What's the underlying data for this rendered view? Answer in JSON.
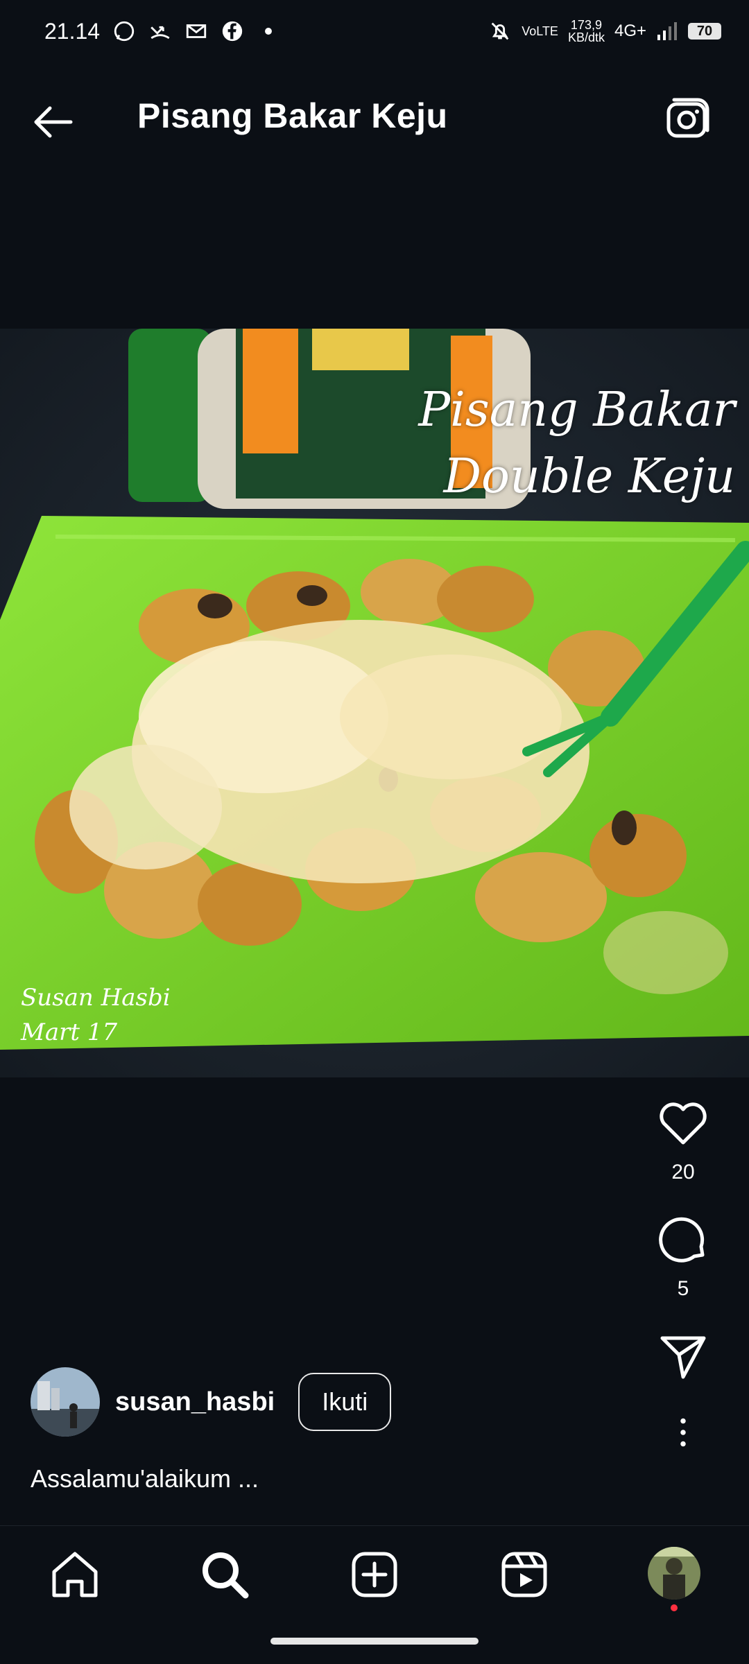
{
  "status_bar": {
    "time": "21.14",
    "network_speed_value": "173,9",
    "network_speed_unit": "KB/dtk",
    "network_type": "4G+",
    "volte": "VoLTE",
    "battery": "70"
  },
  "header": {
    "title": "Pisang Bakar Keju"
  },
  "post": {
    "overlay_title_line1": "Pisang Bakar",
    "overlay_title_line2": "Double Keju",
    "watermark_line1": "Susan Hasbi",
    "watermark_line2": "Mart 17"
  },
  "actions": {
    "likes": "20",
    "comments": "5"
  },
  "author": {
    "username": "susan_hasbi",
    "follow_label": "Ikuti"
  },
  "caption": "Assalamu'alaikum ...",
  "colors": {
    "background": "#0b0f15",
    "plate": "#7ed321",
    "notification": "#ff3040"
  }
}
